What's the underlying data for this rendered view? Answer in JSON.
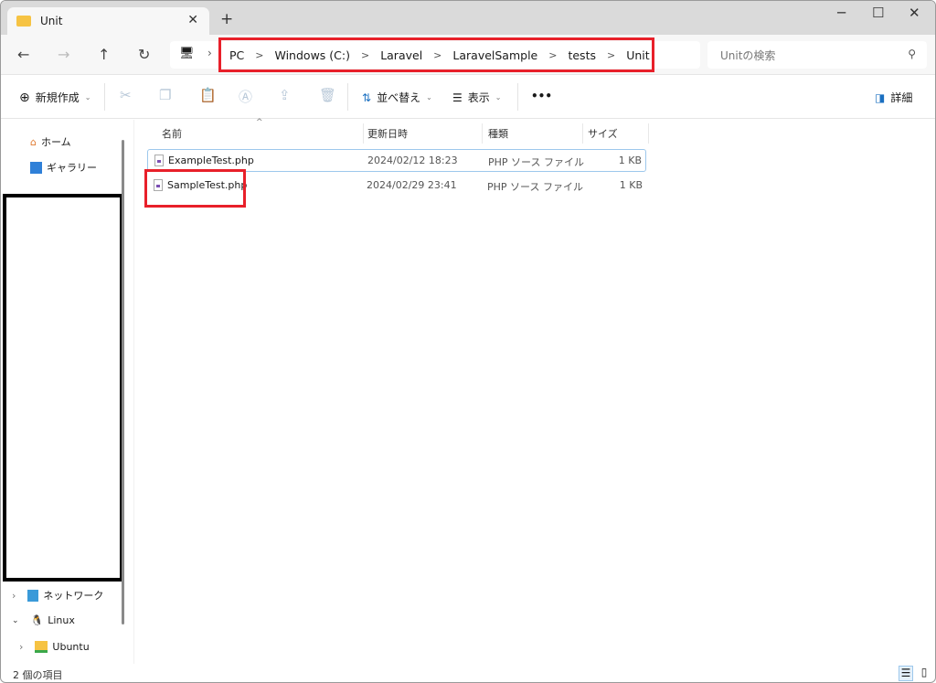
{
  "tab": {
    "title": "Unit",
    "close": "✕",
    "new": "+"
  },
  "window": {
    "minimize": "─",
    "maximize": "☐",
    "close": "✕"
  },
  "nav": {
    "back": "←",
    "forward": "→",
    "up": "↑",
    "refresh": "↻",
    "pc_icon": "🖥",
    "chevron": "›"
  },
  "breadcrumb": [
    "PC",
    "Windows (C:)",
    "Laravel",
    "LaravelSample",
    "tests",
    "Unit"
  ],
  "search": {
    "placeholder": "Unitの検索",
    "icon": "search-icon"
  },
  "toolbar": {
    "new": "新規作成",
    "sort": "並べ替え",
    "view": "表示",
    "more": "•••",
    "details": "詳細"
  },
  "sidebar": {
    "items": [
      {
        "label": "ホーム",
        "icon": "home-icon"
      },
      {
        "label": "ギャラリー",
        "icon": "gallery-icon"
      },
      {
        "label": "ネットワーク",
        "icon": "network-icon"
      },
      {
        "label": "Linux",
        "icon": "linux-icon"
      },
      {
        "label": "Ubuntu",
        "icon": "folder-icon"
      }
    ]
  },
  "columns": [
    "名前",
    "更新日時",
    "種類",
    "サイズ"
  ],
  "files": [
    {
      "name": "ExampleTest.php",
      "modified": "2024/02/12 18:23",
      "type": "PHP ソース ファイル",
      "size": "1 KB"
    },
    {
      "name": "SampleTest.php",
      "modified": "2024/02/29 23:41",
      "type": "PHP ソース ファイル",
      "size": "1 KB"
    }
  ],
  "status": {
    "count": "2 個の項目"
  },
  "colors": {
    "highlight": "#e8202a",
    "selection": "#9dc8ec"
  }
}
